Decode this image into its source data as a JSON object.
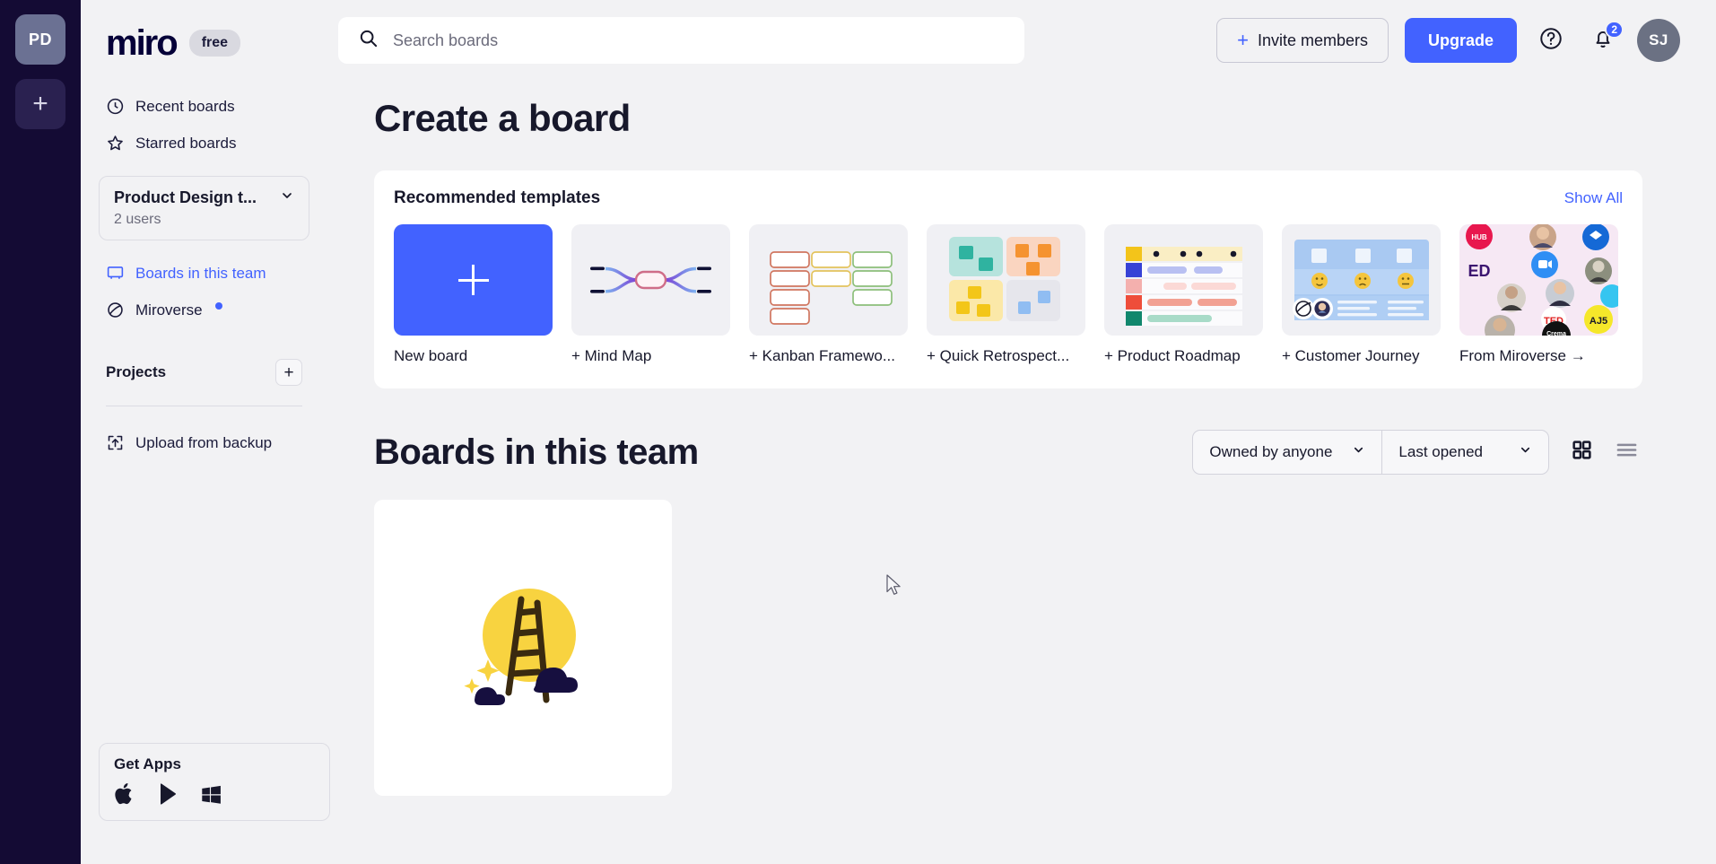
{
  "rail": {
    "team_initials": "PD",
    "add_label": "+"
  },
  "sidebar": {
    "logo_text": "miro",
    "plan_badge": "free",
    "nav": [
      {
        "label": "Recent boards",
        "icon": "clock-icon",
        "active": false
      },
      {
        "label": "Starred boards",
        "icon": "star-icon",
        "active": false
      }
    ],
    "team": {
      "name": "Product Design t...",
      "users": "2 users"
    },
    "team_nav": [
      {
        "label": "Boards in this team",
        "icon": "board-icon",
        "active": true
      },
      {
        "label": "Miroverse",
        "icon": "miroverse-icon",
        "active": false,
        "badge_dot": true
      }
    ],
    "projects": {
      "label": "Projects",
      "add_label": "+"
    },
    "upload": {
      "label": "Upload from backup",
      "icon": "upload-icon"
    },
    "get_apps": {
      "title": "Get Apps",
      "platforms": [
        "apple-icon",
        "google-play-icon",
        "windows-icon"
      ]
    }
  },
  "header": {
    "search_placeholder": "Search boards",
    "search_value": "",
    "search_icon": "search-icon",
    "invite_label": "Invite members",
    "upgrade_label": "Upgrade",
    "help_icon": "help-circle-icon",
    "notifications_icon": "bell-icon",
    "notifications_count": "2",
    "avatar_initials": "SJ"
  },
  "create_board": {
    "title": "Create a board",
    "templates_title": "Recommended templates",
    "show_all_label": "Show All",
    "templates": [
      {
        "label": "New board",
        "thumb": "new-board"
      },
      {
        "label": "+ Mind Map",
        "thumb": "mind-map"
      },
      {
        "label": "+ Kanban Framewo...",
        "thumb": "kanban"
      },
      {
        "label": "+ Quick Retrospect...",
        "thumb": "retrospective"
      },
      {
        "label": "+ Product Roadmap",
        "thumb": "roadmap"
      },
      {
        "label": "+ Customer Journey",
        "thumb": "customer-journey"
      },
      {
        "label": "From Miroverse →",
        "thumb": "miroverse"
      }
    ]
  },
  "boards_section": {
    "title": "Boards in this team",
    "filter_owner": "Owned by anyone",
    "filter_sort": "Last opened",
    "view_grid_icon": "grid-view-icon",
    "view_list_icon": "list-view-icon",
    "cards": [
      {
        "name": "board-thumbnail",
        "illustration": "ladder-sun-clouds"
      }
    ]
  },
  "colors": {
    "accent": "#4262ff",
    "rail_bg": "#140b34",
    "page_bg": "#f2f2f4",
    "text": "#17182b"
  }
}
